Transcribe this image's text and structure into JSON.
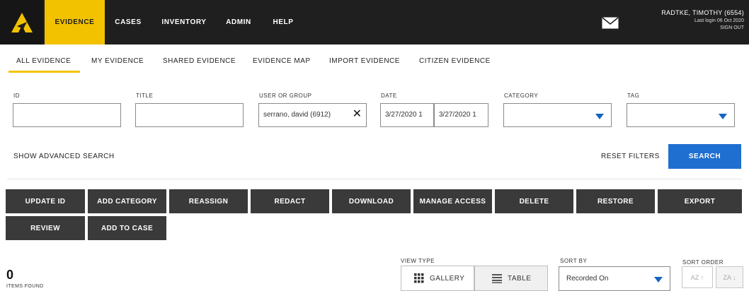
{
  "topnav": {
    "items": [
      "EVIDENCE",
      "CASES",
      "INVENTORY",
      "ADMIN",
      "HELP"
    ],
    "active": "EVIDENCE",
    "user_name": "RADTKE, TIMOTHY (6554)",
    "last_login": "Last login 06 Oct 2020",
    "sign_out": "SIGN OUT",
    "accent_color": "#f2c200"
  },
  "subtabs": [
    "ALL EVIDENCE",
    "MY EVIDENCE",
    "SHARED EVIDENCE",
    "EVIDENCE MAP",
    "IMPORT EVIDENCE",
    "CITIZEN EVIDENCE"
  ],
  "filters": {
    "id_label": "ID",
    "id_value": "",
    "title_label": "TITLE",
    "title_value": "",
    "user_label": "USER OR GROUP",
    "user_value": "serrano, david (6912)",
    "date_label": "DATE",
    "date_from": "3/27/2020 1",
    "date_to": "3/27/2020 1",
    "category_label": "CATEGORY",
    "category_value": "",
    "tag_label": "TAG",
    "tag_value": ""
  },
  "search_controls": {
    "advanced": "SHOW ADVANCED SEARCH",
    "reset": "RESET FILTERS",
    "search": "SEARCH"
  },
  "actions_row1": [
    "UPDATE ID",
    "ADD CATEGORY",
    "REASSIGN",
    "REDACT",
    "DOWNLOAD",
    "MANAGE ACCESS",
    "DELETE",
    "RESTORE",
    "EXPORT"
  ],
  "actions_row2": [
    "REVIEW",
    "ADD TO CASE"
  ],
  "results": {
    "count": "0",
    "count_label": "ITEMS FOUND",
    "view_type_label": "VIEW TYPE",
    "gallery": "GALLERY",
    "table": "TABLE",
    "sort_by_label": "SORT BY",
    "sort_by_value": "Recorded On",
    "sort_order_label": "SORT ORDER",
    "asc": "AZ ↑",
    "desc": "ZA ↓"
  }
}
